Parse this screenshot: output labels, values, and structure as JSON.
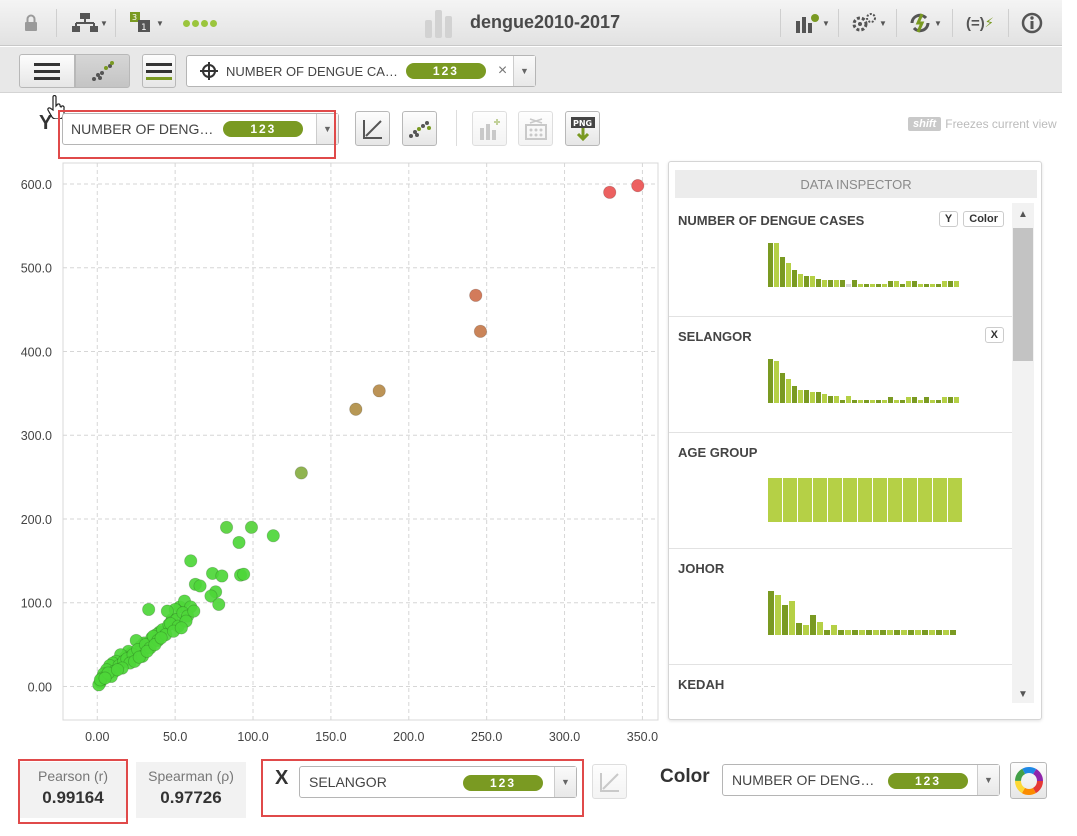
{
  "app": {
    "title": "dengue2010-2017"
  },
  "toolbar": {
    "icons": [
      "lock-icon",
      "model-tree-icon",
      "data-123-icon",
      "progress-dots-icon",
      "chart-icon",
      "settings-icon",
      "sync-icon",
      "formula-icon",
      "info-icon"
    ]
  },
  "objective": {
    "label": "NUMBER OF DENGUE CA…",
    "badge": "123",
    "clear": "×"
  },
  "y_field": {
    "label_letter": "Y",
    "label": "NUMBER OF DENG…",
    "badge": "123"
  },
  "hint": {
    "key": "shift",
    "text": "Freezes current view"
  },
  "inspector": {
    "title": "DATA INSPECTOR",
    "fields": [
      {
        "name": "NUMBER OF DENGUE CASES",
        "tags": [
          "Y",
          "Color"
        ],
        "hist": [
          40,
          40,
          27,
          22,
          15,
          12,
          10,
          10,
          7,
          6,
          6,
          6,
          6,
          2,
          6,
          3,
          3,
          3,
          3,
          3,
          5,
          5,
          3,
          5,
          5,
          3,
          3,
          3,
          3,
          5,
          5,
          5
        ]
      },
      {
        "name": "SELANGOR",
        "tags": [
          "X"
        ],
        "hist": [
          40,
          38,
          27,
          22,
          15,
          12,
          12,
          10,
          10,
          8,
          6,
          6,
          3,
          6,
          3,
          3,
          3,
          3,
          3,
          3,
          5,
          3,
          3,
          5,
          5,
          3,
          5,
          3,
          3,
          5,
          5,
          5
        ]
      },
      {
        "name": "AGE GROUP",
        "tags": [],
        "hist": [
          44,
          44,
          44,
          44,
          44,
          44,
          44,
          44,
          44,
          44,
          44,
          44,
          44
        ]
      },
      {
        "name": "JOHOR",
        "tags": [],
        "hist": [
          44,
          40,
          30,
          34,
          12,
          10,
          20,
          13,
          5,
          10,
          5,
          5,
          5,
          5,
          5,
          5,
          5,
          5,
          5,
          5,
          5,
          5,
          5,
          5,
          5,
          5,
          5
        ]
      },
      {
        "name": "KEDAH",
        "tags": [],
        "hist": []
      }
    ]
  },
  "stats": {
    "pearson_label": "Pearson (r)",
    "pearson_value": "0.99164",
    "spearman_label": "Spearman (ρ)",
    "spearman_value": "0.97726"
  },
  "x_field": {
    "label_letter": "X",
    "label": "SELANGOR",
    "badge": "123"
  },
  "color_field": {
    "label": "Color",
    "value": "NUMBER OF DENG…",
    "badge": "123"
  },
  "chart_data": {
    "type": "scatter",
    "xlabel": "SELANGOR",
    "ylabel": "NUMBER OF DENGUE CASES",
    "xlim": [
      -22,
      360
    ],
    "ylim": [
      -40,
      625
    ],
    "x_ticks": [
      "0.00",
      "50.0",
      "100.0",
      "150.0",
      "200.0",
      "250.0",
      "300.0",
      "350.0"
    ],
    "y_ticks": [
      "0.00",
      "100.0",
      "200.0",
      "300.0",
      "400.0",
      "500.0",
      "600.0"
    ],
    "points": [
      [
        347,
        598
      ],
      [
        329,
        590
      ],
      [
        243,
        467
      ],
      [
        246,
        424
      ],
      [
        181,
        353
      ],
      [
        166,
        331
      ],
      [
        131,
        255
      ],
      [
        83,
        190
      ],
      [
        99,
        190
      ],
      [
        91,
        172
      ],
      [
        113,
        180
      ],
      [
        60,
        150
      ],
      [
        63,
        122
      ],
      [
        66,
        120
      ],
      [
        74,
        135
      ],
      [
        80,
        132
      ],
      [
        92,
        133
      ],
      [
        94,
        134
      ],
      [
        76,
        113
      ],
      [
        73,
        108
      ],
      [
        78,
        98
      ],
      [
        48,
        80
      ],
      [
        53,
        95
      ],
      [
        56,
        102
      ],
      [
        33,
        92
      ],
      [
        60,
        95
      ],
      [
        50,
        92
      ],
      [
        45,
        90
      ],
      [
        40,
        65
      ],
      [
        38,
        62
      ],
      [
        35,
        58
      ],
      [
        30,
        52
      ],
      [
        28,
        48
      ],
      [
        25,
        55
      ],
      [
        22,
        40
      ],
      [
        20,
        42
      ],
      [
        18,
        35
      ],
      [
        15,
        38
      ],
      [
        12,
        30
      ],
      [
        10,
        28
      ],
      [
        8,
        25
      ],
      [
        6,
        20
      ],
      [
        4,
        15
      ],
      [
        3,
        10
      ],
      [
        2,
        5
      ],
      [
        1,
        2
      ],
      [
        2,
        8
      ],
      [
        14,
        25
      ],
      [
        17,
        30
      ],
      [
        19,
        33
      ],
      [
        23,
        38
      ],
      [
        26,
        44
      ],
      [
        31,
        50
      ],
      [
        36,
        60
      ],
      [
        42,
        68
      ],
      [
        46,
        74
      ],
      [
        51,
        80
      ],
      [
        55,
        88
      ],
      [
        58,
        84
      ],
      [
        21,
        28
      ],
      [
        16,
        22
      ],
      [
        11,
        18
      ],
      [
        9,
        12
      ],
      [
        7,
        16
      ],
      [
        5,
        10
      ],
      [
        13,
        20
      ],
      [
        24,
        30
      ],
      [
        29,
        36
      ],
      [
        34,
        46
      ],
      [
        39,
        55
      ],
      [
        44,
        62
      ],
      [
        47,
        75
      ],
      [
        52,
        72
      ],
      [
        57,
        78
      ],
      [
        62,
        90
      ],
      [
        27,
        35
      ],
      [
        32,
        42
      ],
      [
        37,
        50
      ],
      [
        41,
        58
      ],
      [
        49,
        66
      ],
      [
        54,
        70
      ]
    ]
  }
}
